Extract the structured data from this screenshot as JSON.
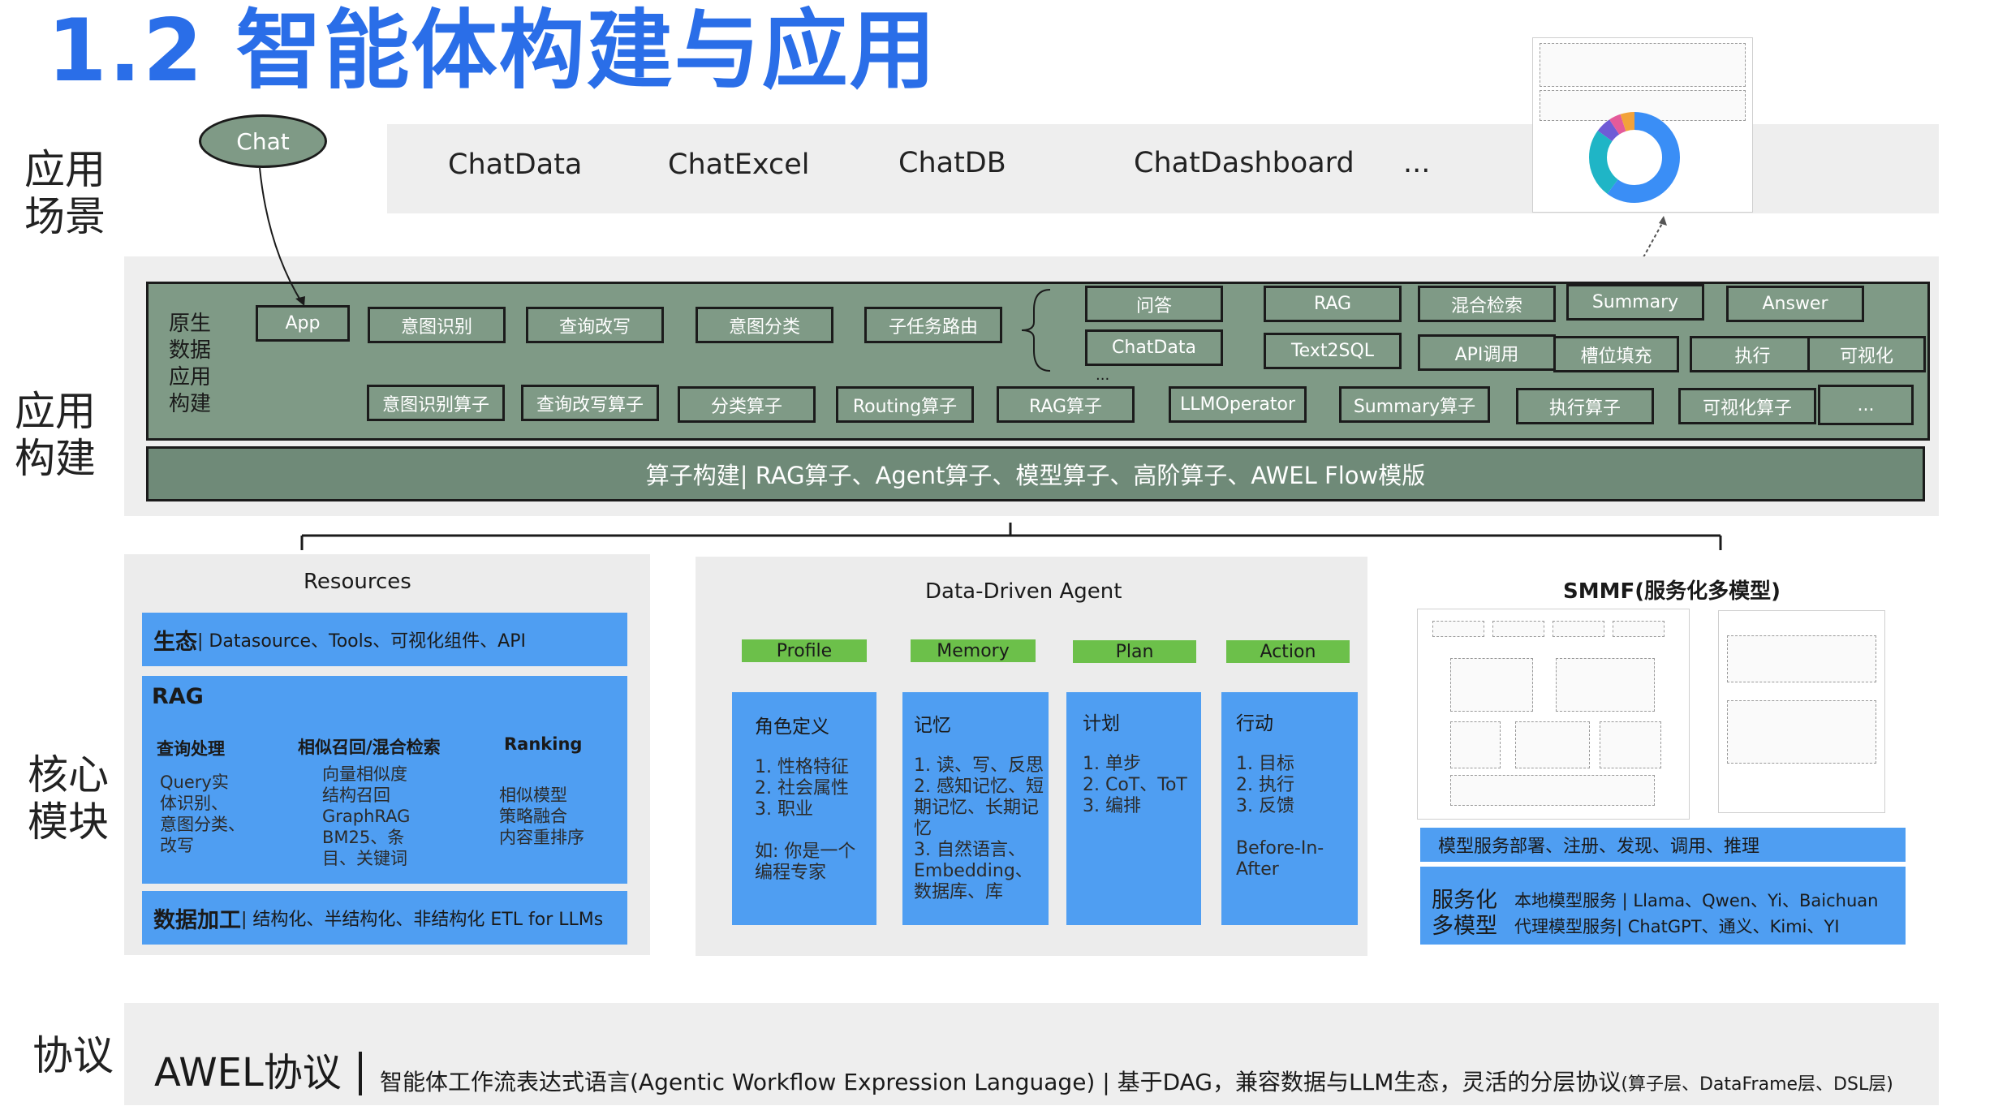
{
  "title": "1.2 智能体构建与应用",
  "rows": {
    "scenarios": [
      "应用",
      "场景"
    ],
    "build": [
      "应用",
      "构建"
    ],
    "core": [
      "核心",
      "模块"
    ],
    "protocol": "协议"
  },
  "scenarios": {
    "bubble": "Chat",
    "items": [
      "ChatData",
      "ChatExcel",
      "ChatDB",
      "ChatDashboard",
      "..."
    ]
  },
  "build": {
    "native_label": [
      "原生",
      "数据",
      "应用",
      "构建"
    ],
    "flow_row": [
      "App",
      "意图识别",
      "查询改写",
      "意图分类",
      "子任务路由"
    ],
    "branch_top": [
      "问答",
      "RAG",
      "混合检索",
      "Summary",
      "Answer"
    ],
    "branch_bottom": [
      "ChatData",
      "Text2SQL",
      "API调用",
      "槽位填充",
      "执行",
      "可视化"
    ],
    "branch_more": "...",
    "operators": [
      "意图识别算子",
      "查询改写算子",
      "分类算子",
      "Routing算子",
      "RAG算子",
      "LLMOperator",
      "Summary算子",
      "执行算子",
      "可视化算子",
      "..."
    ],
    "bar": "算子构建| RAG算子、Agent算子、模型算子、高阶算子、AWEL Flow模版"
  },
  "resources": {
    "title": "Resources",
    "eco_bold": "生态",
    "eco_rest": " | Datasource、Tools、可视化组件、API",
    "rag_title": "RAG",
    "rag_cols": [
      {
        "head": "查询处理",
        "body": [
          "Query实",
          "体识别、",
          "意图分类、",
          "改写"
        ]
      },
      {
        "head": "相似召回/混合检索",
        "body": [
          "向量相似度",
          "结构召回",
          "GraphRAG",
          "BM25、条",
          "目、关键词"
        ]
      },
      {
        "head": "Ranking",
        "body": [
          "相似模型",
          "策略融合",
          "内容重排序"
        ]
      }
    ],
    "proc_bold": "数据加工",
    "proc_rest": " | 结构化、半结构化、非结构化 ETL for LLMs"
  },
  "agent": {
    "title": "Data-Driven Agent",
    "cols": [
      {
        "tab": "Profile",
        "head": "角色定义",
        "lines": [
          "1. 性格特征",
          "2. 社会属性",
          "3. 职业",
          "",
          "如: 你是一个",
          "编程专家"
        ]
      },
      {
        "tab": "Memory",
        "head": "记忆",
        "lines": [
          "1. 读、写、反思",
          "2. 感知记忆、短",
          "期记忆、长期记",
          "忆",
          "3. 自然语言、",
          "Embedding、",
          "数据库、库"
        ]
      },
      {
        "tab": "Plan",
        "head": "计划",
        "lines": [
          "1. 单步",
          "2. CoT、ToT",
          "3. 编排"
        ]
      },
      {
        "tab": "Action",
        "head": "行动",
        "lines": [
          "1. 目标",
          "2. 执行",
          "3. 反馈",
          "",
          "Before-In-After"
        ]
      }
    ]
  },
  "smmf": {
    "title": "SMMF(服务化多模型)",
    "deploy": "模型服务部署、注册、发现、调用、推理",
    "left_label": [
      "服务化",
      "多模型"
    ],
    "line1": "本地模型服务 | Llama、Qwen、Yi、Baichuan",
    "line2": "代理模型服务| ChatGPT、通义、Kimi、YI"
  },
  "protocol": {
    "name": "AWEL协议",
    "desc": "智能体工作流表达式语言(Agentic Workflow Expression Language) | 基于DAG，兼容数据与LLM生态，灵活的分层协议",
    "small": "(算子层、DataFrame层、DSL层)"
  },
  "colors": {
    "accent": "#2a6ee8",
    "band": "#eeeeee",
    "green_box": "#7f9a86",
    "blue": "#4f9ef2",
    "tab_green": "#6cc04a",
    "donut": [
      "#3a8ef6",
      "#1fb5c6",
      "#2b6ad4",
      "#6f5bd6",
      "#e45a9a",
      "#f2a23a"
    ]
  }
}
